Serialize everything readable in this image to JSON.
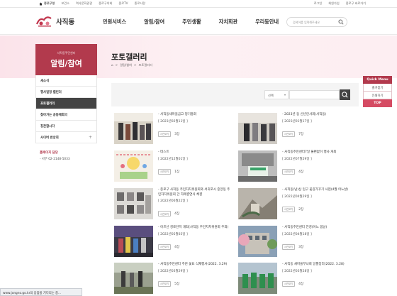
{
  "utilbar": {
    "home": "종로구청",
    "links": [
      "보건소",
      "역사문화관광",
      "종로구의회",
      "종로TV",
      "종로사랑"
    ],
    "right": [
      "로그인",
      "회원가입",
      "종로구 바로가기"
    ]
  },
  "header": {
    "logo_name": "사직동",
    "gnb": [
      "민원서비스",
      "알림/참여",
      "주민생활",
      "자치회관",
      "우리동안내"
    ],
    "search_placeholder": "검색어를 입력해주세요"
  },
  "sidebar": {
    "sub": "사직동주민센터",
    "title": "알림/참여",
    "items": [
      {
        "label": "새소식",
        "active": false,
        "plus": ""
      },
      {
        "label": "행사일정 캘린더",
        "active": false,
        "plus": ""
      },
      {
        "label": "포토갤러리",
        "active": true,
        "plus": ""
      },
      {
        "label": "찾아가는 공동체회의",
        "active": false,
        "plus": ""
      },
      {
        "label": "칭찬합시다",
        "active": false,
        "plus": ""
      },
      {
        "label": "사이버 반상회",
        "active": false,
        "plus": "+"
      }
    ],
    "contact_label": "홈페이지 담당",
    "contact_tel": "- 서무 02-2148-5033"
  },
  "content": {
    "title": "포토갤러리",
    "breadcrumb": [
      "⌂",
      ">",
      "알림/참여",
      ">",
      "포토갤러리"
    ],
    "search_select": "선택"
  },
  "gallery": [
    {
      "title": "- 사직동새마을금고 정기총회",
      "date": "[ 2023년02월11일 ]",
      "tag": "사진보기",
      "views": "3장"
    },
    {
      "title": "- 2023년 동 신년인사회(사직동)",
      "date": "[ 2023년01월17일 ]",
      "tag": "사진보기",
      "views": "7장"
    },
    {
      "title": "- 테스트",
      "date": "[ 2022년12월01일 ]",
      "tag": "사진보기",
      "views": "1장"
    },
    {
      "title": "- 사직동주민센터7일 불편없이 행사 개최",
      "date": "[ 2022년07월29일 ]",
      "tag": "사진보기",
      "views": "4장"
    },
    {
      "title": "- 종로구 사직동 주민자치위원회와 서귀포시 중앙동 주민자치위원회 간 자매결연식 체결",
      "date": "[ 2022년06월22일 ]",
      "tag": "사진보기",
      "views": "4장"
    },
    {
      "title": "- 사직동(남)상 입구 꽃길가꾸기 사업(4월 어느날)",
      "date": "[ 2022년04월29일 ]",
      "tag": "사진보기",
      "views": "2장"
    },
    {
      "title": "- 어르신 경로잔치 개최(사직동 주민자치위원회 주최)",
      "date": "[ 2022년05월03일 ]",
      "tag": "사진보기",
      "views": "4장"
    },
    {
      "title": "- 사직동주민센터 전경(어느 봄날)",
      "date": "[ 2022년04월18일 ]",
      "tag": "사진보기",
      "views": "3장"
    },
    {
      "title": "- 사직동주민센터 주변 꽃묘 식재행사(2022. 3.29)",
      "date": "[ 2022년03월29일 ]",
      "tag": "사진보기",
      "views": "5장"
    },
    {
      "title": "- 사직동 새마을부녀회 일월장터(2022. 3.28)",
      "date": "[ 2022년03월28일 ]",
      "tag": "사진보기",
      "views": "4장"
    }
  ],
  "quick": {
    "head": "Quick Menu",
    "items": [
      "즐겨찾기",
      "인쇄하기"
    ],
    "top": "TOP"
  },
  "status": "www.jongno.go.kr의 응답을 기다리는 중..."
}
